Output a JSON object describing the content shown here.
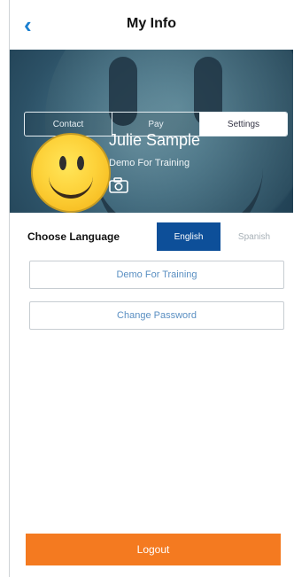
{
  "header": {
    "title": "My Info",
    "back_icon": "chevron-left-icon"
  },
  "tabs": [
    {
      "label": "Contact",
      "active": false
    },
    {
      "label": "Pay",
      "active": false
    },
    {
      "label": "Settings",
      "active": true
    }
  ],
  "profile": {
    "name": "Julie  Sample",
    "subtitle": "Demo For Training",
    "camera_icon": "camera-icon",
    "avatar": "smiley-face-avatar"
  },
  "language": {
    "label": "Choose Language",
    "options": [
      "English",
      "Spanish"
    ],
    "selected": "English"
  },
  "actions": {
    "demo_label": "Demo For Training",
    "change_password_label": "Change Password",
    "logout_label": "Logout"
  },
  "colors": {
    "accent_blue": "#1a7fd0",
    "selected_lang": "#0d4f99",
    "logout": "#f47a20"
  }
}
